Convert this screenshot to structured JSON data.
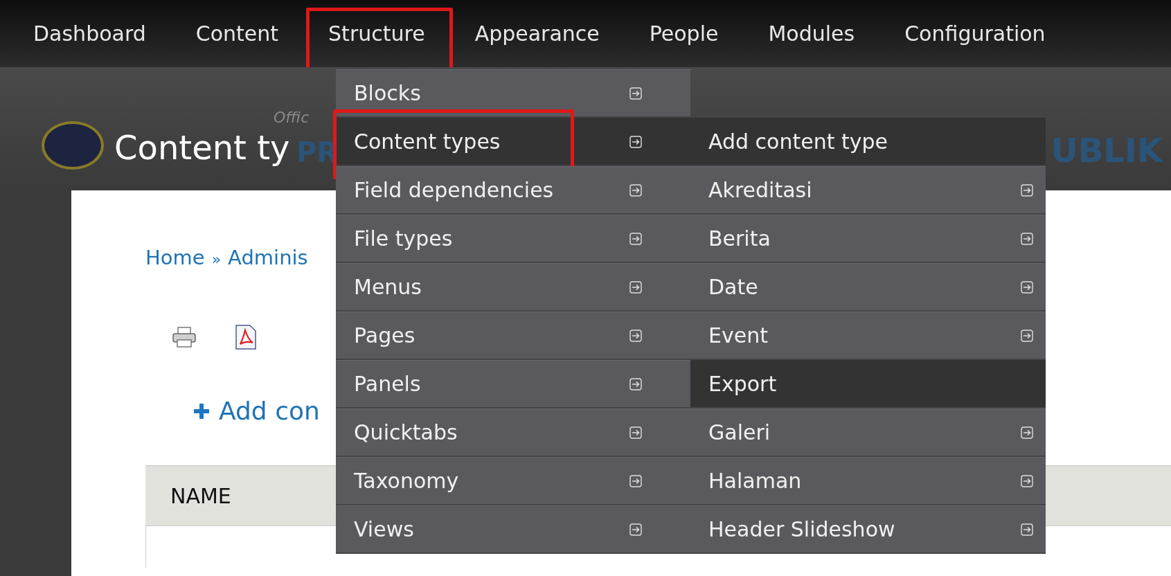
{
  "nav": [
    {
      "label": "Dashboard",
      "highlighted": false
    },
    {
      "label": "Content",
      "highlighted": false
    },
    {
      "label": "Structure",
      "highlighted": true
    },
    {
      "label": "Appearance",
      "highlighted": false
    },
    {
      "label": "People",
      "highlighted": false
    },
    {
      "label": "Modules",
      "highlighted": false
    },
    {
      "label": "Configuration",
      "highlighted": false
    }
  ],
  "banner": {
    "tagline": "Offic",
    "name_start": "PR",
    "name_end": "UBLIK"
  },
  "page_title": "Content ty",
  "breadcrumb": {
    "links": [
      "Home",
      "Adminis"
    ],
    "separator": "»"
  },
  "add_link": {
    "label": "Add con"
  },
  "table": {
    "columns": [
      "NAME"
    ]
  },
  "menu": {
    "items": [
      {
        "label": "Blocks",
        "active": false,
        "highlighted": false,
        "has_submenu": true
      },
      {
        "label": "Content types",
        "active": true,
        "highlighted": true,
        "has_submenu": true
      },
      {
        "label": "Field dependencies",
        "active": false,
        "highlighted": false,
        "has_submenu": true
      },
      {
        "label": "File types",
        "active": false,
        "highlighted": false,
        "has_submenu": true
      },
      {
        "label": "Menus",
        "active": false,
        "highlighted": false,
        "has_submenu": true
      },
      {
        "label": "Pages",
        "active": false,
        "highlighted": false,
        "has_submenu": true
      },
      {
        "label": "Panels",
        "active": false,
        "highlighted": false,
        "has_submenu": true
      },
      {
        "label": "Quicktabs",
        "active": false,
        "highlighted": false,
        "has_submenu": true
      },
      {
        "label": "Taxonomy",
        "active": false,
        "highlighted": false,
        "has_submenu": true
      },
      {
        "label": "Views",
        "active": false,
        "highlighted": false,
        "has_submenu": true
      }
    ]
  },
  "submenu": {
    "items": [
      {
        "label": "Add content type",
        "active": true,
        "has_submenu": false
      },
      {
        "label": "Akreditasi",
        "active": false,
        "has_submenu": true
      },
      {
        "label": "Berita",
        "active": false,
        "has_submenu": true
      },
      {
        "label": "Date",
        "active": false,
        "has_submenu": true
      },
      {
        "label": "Event",
        "active": false,
        "has_submenu": true
      },
      {
        "label": "Export",
        "active": true,
        "has_submenu": false
      },
      {
        "label": "Galeri",
        "active": false,
        "has_submenu": true
      },
      {
        "label": "Halaman",
        "active": false,
        "has_submenu": true
      },
      {
        "label": "Header Slideshow",
        "active": false,
        "has_submenu": true
      }
    ]
  }
}
